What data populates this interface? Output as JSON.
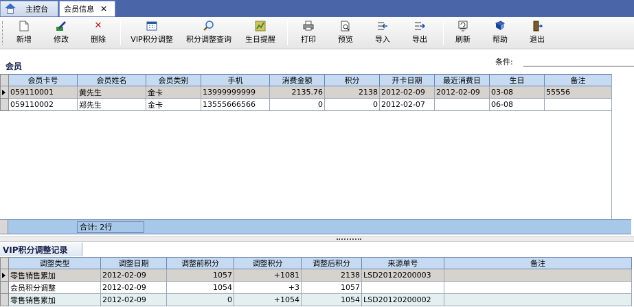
{
  "tabs": [
    {
      "label": "主控台"
    },
    {
      "label": "会员信息",
      "close": "✕"
    }
  ],
  "toolbar": {
    "buttons": [
      {
        "label": "新增",
        "icon": "new-document-icon"
      },
      {
        "label": "修改",
        "icon": "edit-icon"
      },
      {
        "label": "删除",
        "icon": "delete-icon"
      },
      {
        "label": "VIP积分调整",
        "icon": "calendar-grid-icon"
      },
      {
        "label": "积分调整查询",
        "icon": "magnifier-icon"
      },
      {
        "label": "生日提醒",
        "icon": "birthday-map-icon"
      },
      {
        "label": "打印",
        "icon": "printer-icon"
      },
      {
        "label": "预览",
        "icon": "preview-icon"
      },
      {
        "label": "导入",
        "icon": "import-icon"
      },
      {
        "label": "导出",
        "icon": "export-icon"
      },
      {
        "label": "刷新",
        "icon": "refresh-icon"
      },
      {
        "label": "帮助",
        "icon": "help-book-icon"
      },
      {
        "label": "退出",
        "icon": "exit-door-icon"
      }
    ]
  },
  "members": {
    "title": "会员",
    "condition_label": "条件:",
    "condition_value": "",
    "columns": [
      "会员卡号",
      "会员姓名",
      "会员类别",
      "手机",
      "消费金额",
      "积分",
      "开卡日期",
      "最近消费日",
      "生日",
      "备注"
    ],
    "rows": [
      [
        "059110001",
        "黄先生",
        "金卡",
        "13999999999",
        "2135.76",
        "2138",
        "2012-02-09",
        "2012-02-09",
        "03-08",
        "55556"
      ],
      [
        "059110002",
        "郑先生",
        "金卡",
        "13555666566",
        "0",
        "0",
        "2012-02-07",
        "",
        "06-08",
        ""
      ]
    ],
    "summary": "合计: 2行"
  },
  "vip_log": {
    "title": "VIP积分调整记录",
    "columns": [
      "调整类型",
      "调整日期",
      "调整前积分",
      "调整积分",
      "调整后积分",
      "来源单号",
      "备注"
    ],
    "rows": [
      [
        "零售销售累加",
        "2012-02-09",
        "1057",
        "+1081",
        "2138",
        "LSD20120200003",
        ""
      ],
      [
        "会员积分调整",
        "2012-02-09",
        "1054",
        "+3",
        "1057",
        "",
        ""
      ],
      [
        "零售销售累加",
        "2012-02-09",
        "0",
        "+1054",
        "1054",
        "LSD20120200002",
        ""
      ]
    ]
  },
  "colors": {
    "tab_bar": "#4a65a8",
    "grid_header": "#c6dbf2",
    "summary_bar": "#a8c8ea",
    "selected_row": "#d6d3ce"
  }
}
